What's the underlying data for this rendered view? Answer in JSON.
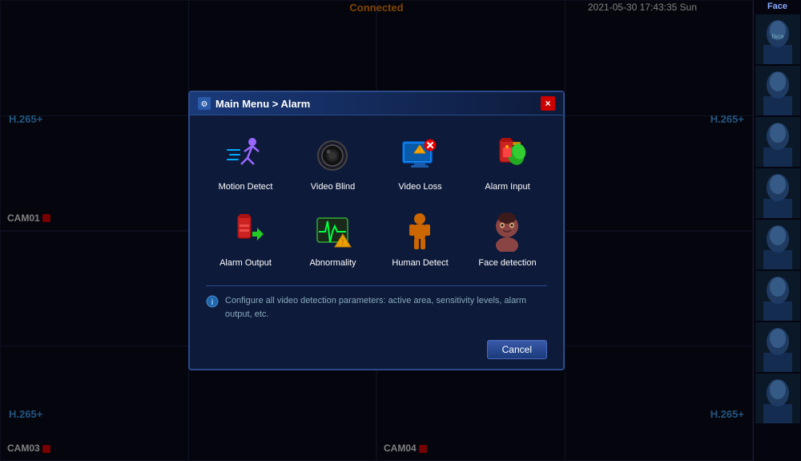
{
  "topbar": {
    "connected_label": "Connected",
    "datetime": "2021-05-30 17:43:35 Sun"
  },
  "cameras": [
    {
      "id": "cam1",
      "label": "",
      "h265": "H.265+",
      "position": "top-left"
    },
    {
      "id": "cam2",
      "label": "",
      "h265": "H.265+",
      "position": "top-right"
    },
    {
      "id": "cam3",
      "label": "CAM03",
      "h265": "H.265+",
      "position": "bottom-left"
    },
    {
      "id": "cam4",
      "label": "CAM04",
      "h265": "H.265+",
      "position": "bottom-right"
    }
  ],
  "cam_labels": {
    "cam1": "CAM01",
    "cam3": "CAM03",
    "cam4": "CAM04"
  },
  "face_panel": {
    "title": "Face"
  },
  "dialog": {
    "title": "Main Menu > Alarm",
    "close_label": "×",
    "cancel_label": "Cancel",
    "info_text": "Configure all video detection parameters: active area, sensitivity levels, alarm output, etc.",
    "menu_items": [
      {
        "id": "motion-detect",
        "label": "Motion Detect"
      },
      {
        "id": "video-blind",
        "label": "Video Blind"
      },
      {
        "id": "video-loss",
        "label": "Video Loss"
      },
      {
        "id": "alarm-input",
        "label": "Alarm Input"
      },
      {
        "id": "alarm-output",
        "label": "Alarm Output"
      },
      {
        "id": "abnormality",
        "label": "Abnormality"
      },
      {
        "id": "human-detect",
        "label": "Human Detect"
      },
      {
        "id": "face-detection",
        "label": "Face detection"
      }
    ]
  }
}
